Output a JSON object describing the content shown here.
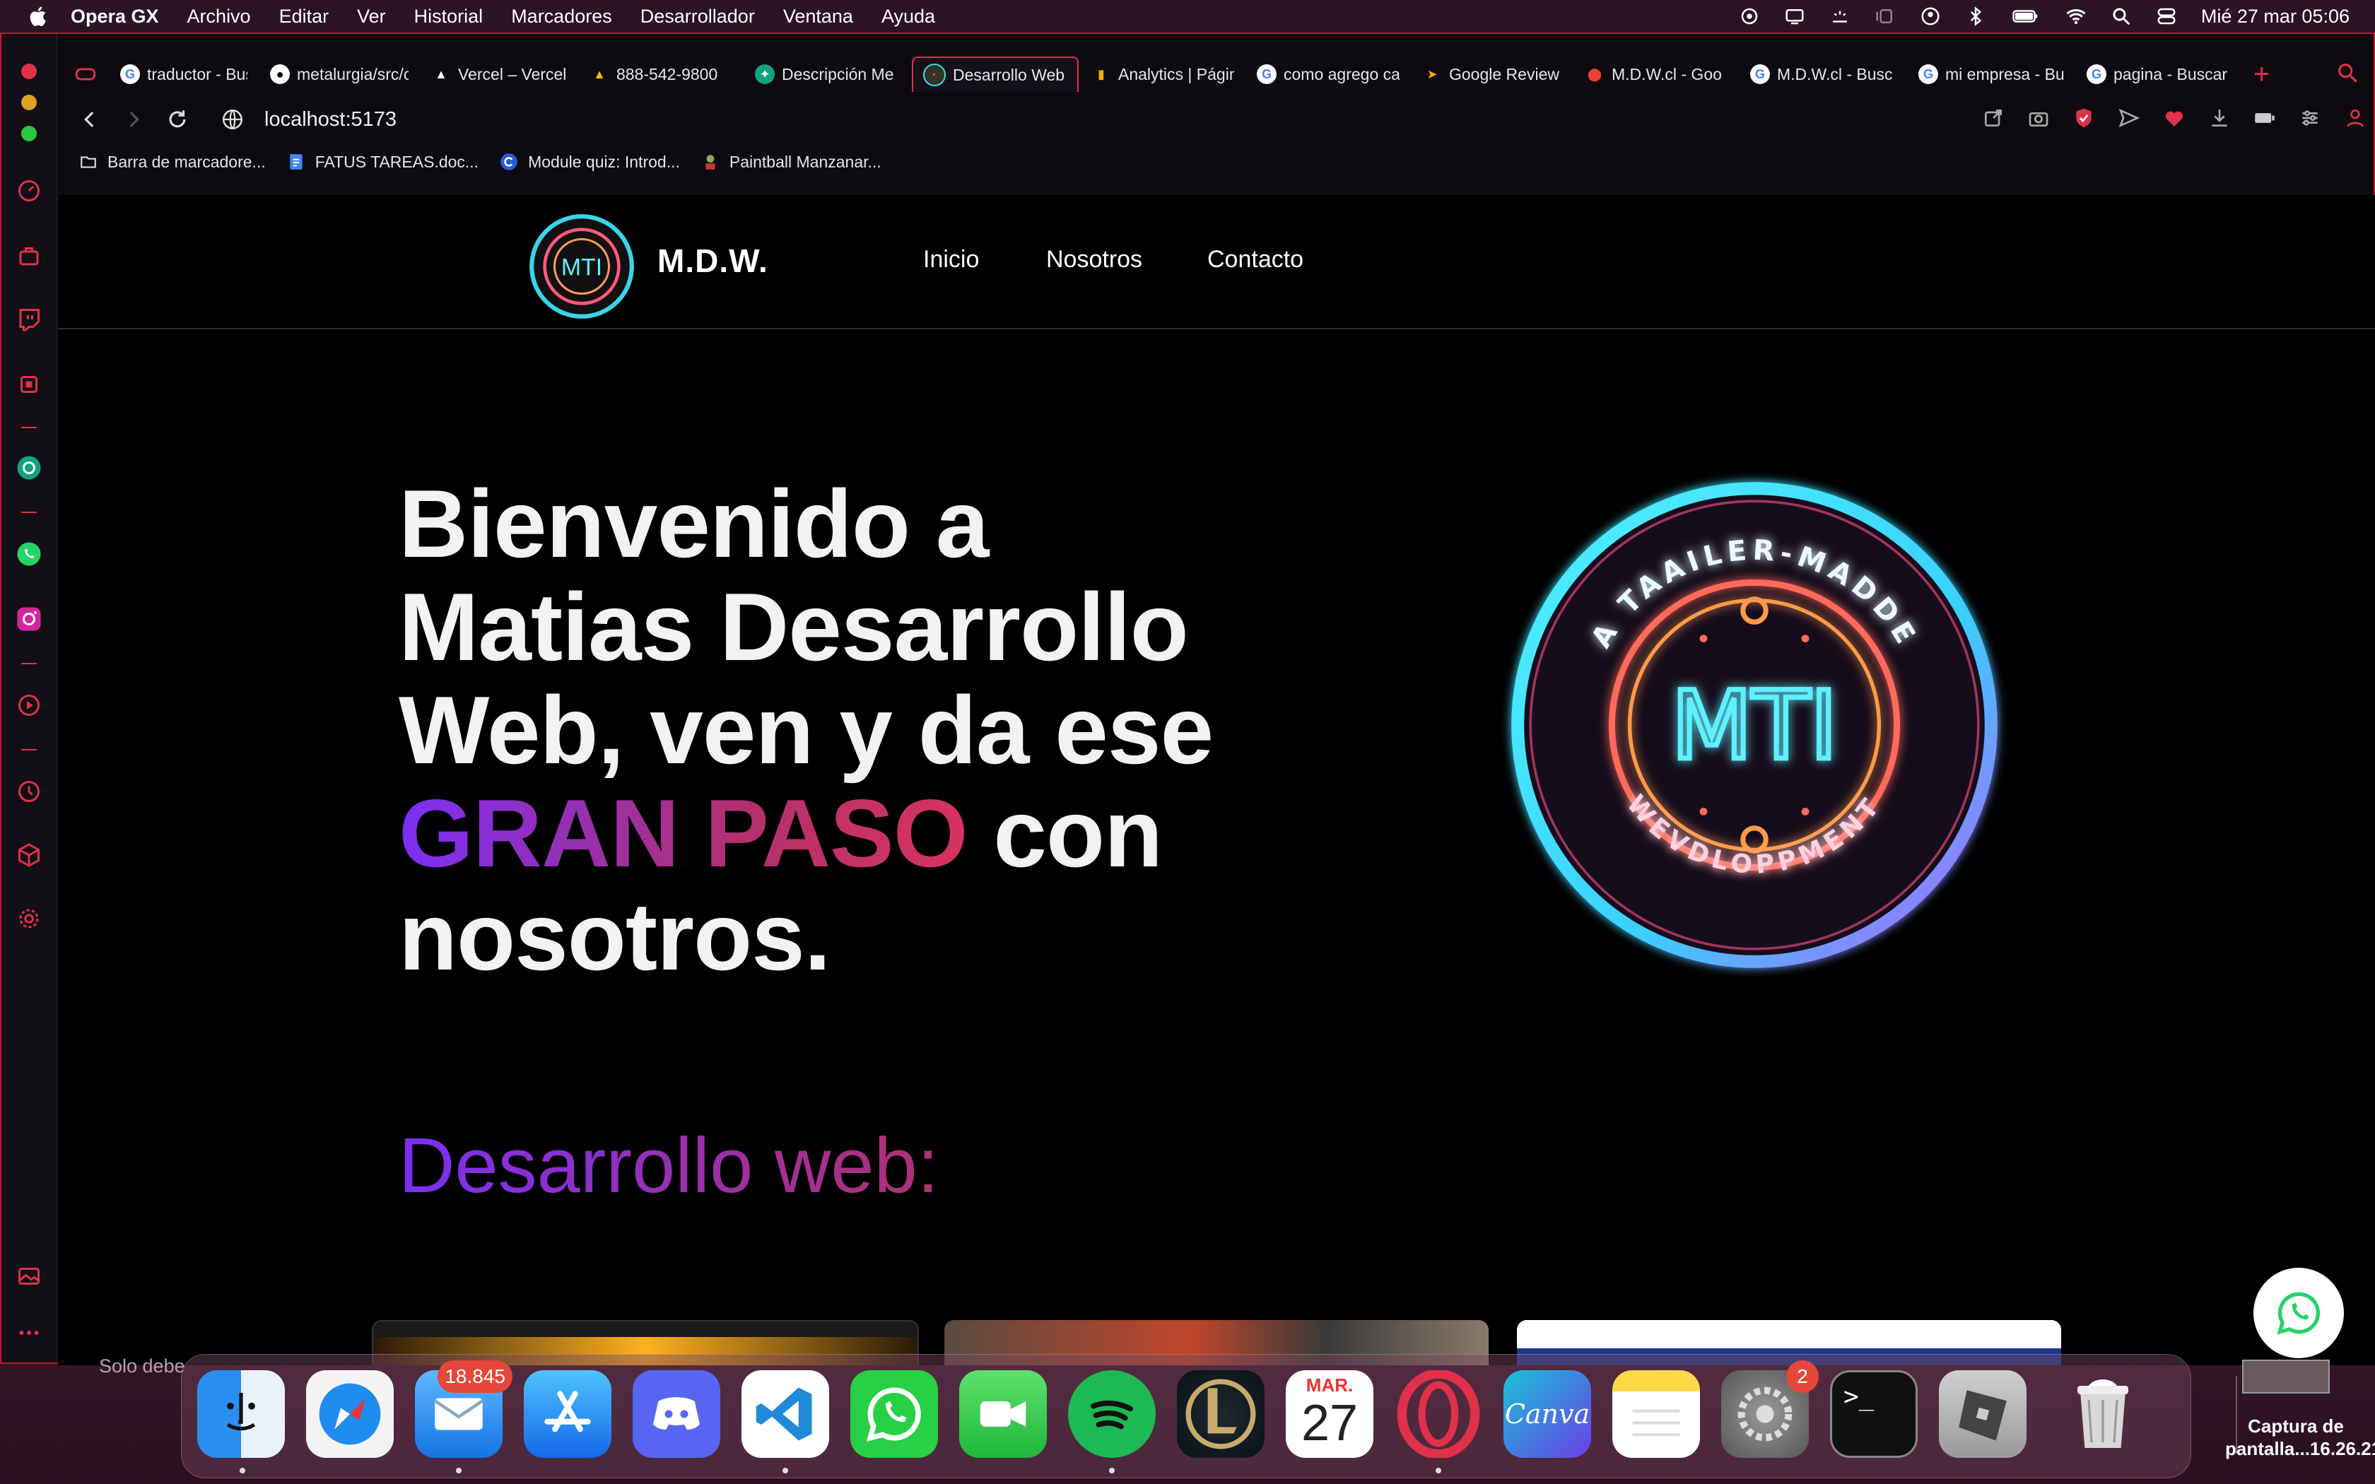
{
  "menubar": {
    "app_name": "Opera GX",
    "items": [
      "Archivo",
      "Editar",
      "Ver",
      "Historial",
      "Marcadores",
      "Desarrollador",
      "Ventana",
      "Ayuda"
    ],
    "clock": "Mié 27 mar  05:06"
  },
  "tabs": [
    {
      "label": "traductor - Busc",
      "icon": "google-icon"
    },
    {
      "label": "metalurgia/src/c",
      "icon": "github-icon"
    },
    {
      "label": "Vercel – Vercel",
      "icon": "vercel-icon"
    },
    {
      "label": "888-542-9800",
      "icon": "google-ads-icon"
    },
    {
      "label": "Descripción Me",
      "icon": "chatgpt-icon"
    },
    {
      "label": "Desarrollo Web",
      "icon": "site-icon",
      "active": true
    },
    {
      "label": "Analytics | Págin",
      "icon": "analytics-icon"
    },
    {
      "label": "como agrego ca",
      "icon": "google-icon"
    },
    {
      "label": "Google Review",
      "icon": "arrow-icon"
    },
    {
      "label": "M.D.W.cl - Goo",
      "icon": "maps-icon"
    },
    {
      "label": "M.D.W.cl - Busc",
      "icon": "google-icon"
    },
    {
      "label": "mi empresa - Bu",
      "icon": "google-icon"
    },
    {
      "label": "pagina - Buscar",
      "icon": "google-icon"
    }
  ],
  "address_bar": {
    "url": "localhost:5173"
  },
  "bookmarks": [
    {
      "label": "Barra de marcadore...",
      "icon": "folder-icon"
    },
    {
      "label": "FATUS TAREAS.doc...",
      "icon": "docs-icon"
    },
    {
      "label": "Module quiz: Introd...",
      "icon": "coursera-icon"
    },
    {
      "label": "Paintball Manzanar...",
      "icon": "paintball-icon"
    }
  ],
  "site": {
    "brand": "M.D.W.",
    "nav": [
      "Inicio",
      "Nosotros",
      "Contacto"
    ],
    "hero": {
      "line1": "Bienvenido a",
      "line2": "Matias Desarrollo",
      "line3": "Web, ven y da ese",
      "highlight": "GRAN PASO",
      "line4_rest": " con",
      "line5": "nosotros."
    },
    "logo": {
      "monogram": "MTI",
      "ring_top": "A TAAILER-MADDE",
      "ring_bottom": "WEVDLOPPMENT",
      "small_monogram": "MTI"
    },
    "section_title": "Desarrollo web:"
  },
  "colors": {
    "accent": "#e0304a",
    "gradient_start": "#7b2ff7",
    "gradient_end": "#d8335f",
    "page_bg": "#000000"
  },
  "dock": {
    "mail_badge": "18.845",
    "settings_badge": "2",
    "calendar_month": "MAR.",
    "calendar_day": "27",
    "canva_label": "Canva"
  },
  "desktop": {
    "partial_text": "Solo debe",
    "screenshot_label_1": "Captura de",
    "screenshot_label_2": "pantalla...16.26.21"
  }
}
